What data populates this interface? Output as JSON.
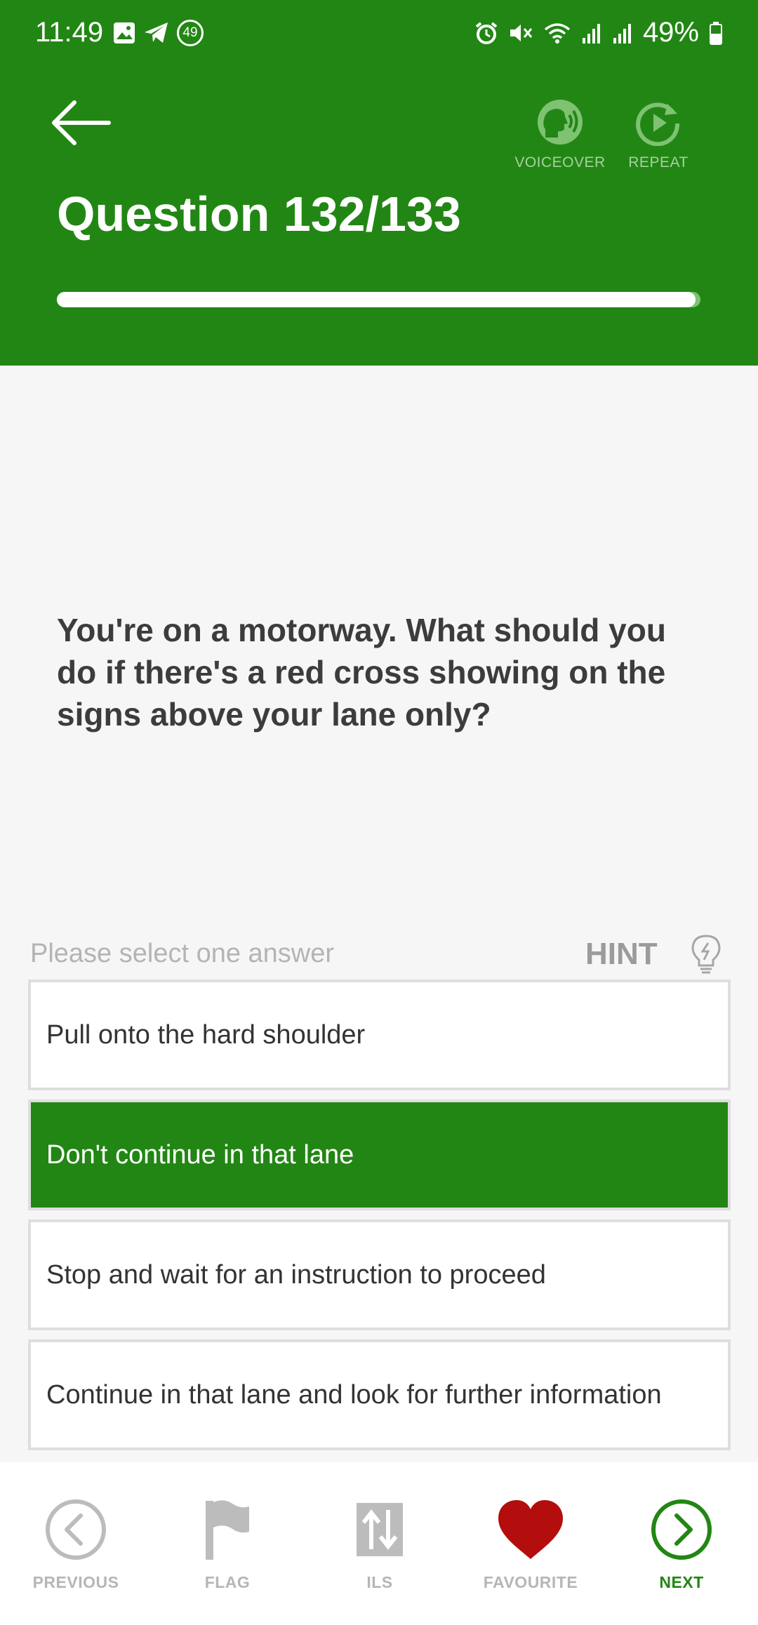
{
  "status_bar": {
    "time": "11:49",
    "notification_count": "49",
    "battery": "49%"
  },
  "header": {
    "title": "Question 132/133",
    "progress_fraction": 0.992,
    "voiceover_label": "VOICEOVER",
    "repeat_label": "REPEAT",
    "accent_color": "#228614"
  },
  "question": {
    "text": "You're on a motorway. What should you do if there's a red cross showing on the signs above your lane only?"
  },
  "answers_section": {
    "prompt": "Please select one answer",
    "hint_label": "HINT"
  },
  "answers": [
    {
      "text": "Pull onto the hard shoulder",
      "selected": false
    },
    {
      "text": "Don't continue in that lane",
      "selected": true
    },
    {
      "text": "Stop and wait for an instruction to proceed",
      "selected": false
    },
    {
      "text": "Continue in that lane and look for further information",
      "selected": false
    }
  ],
  "bottom_nav": {
    "previous": "PREVIOUS",
    "flag": "FLAG",
    "ils": "ILS",
    "favourite": "FAVOURITE",
    "next": "NEXT"
  },
  "icons": {
    "back": "arrow-left-icon",
    "voiceover": "speaking-head-icon",
    "repeat": "replay-icon",
    "hint": "lightbulb-icon",
    "previous": "chevron-left-circle-icon",
    "flag": "flag-icon",
    "ils": "sort-arrows-icon",
    "favourite": "heart-icon",
    "next": "chevron-right-circle-icon",
    "favourite_color": "#b30d0d"
  }
}
